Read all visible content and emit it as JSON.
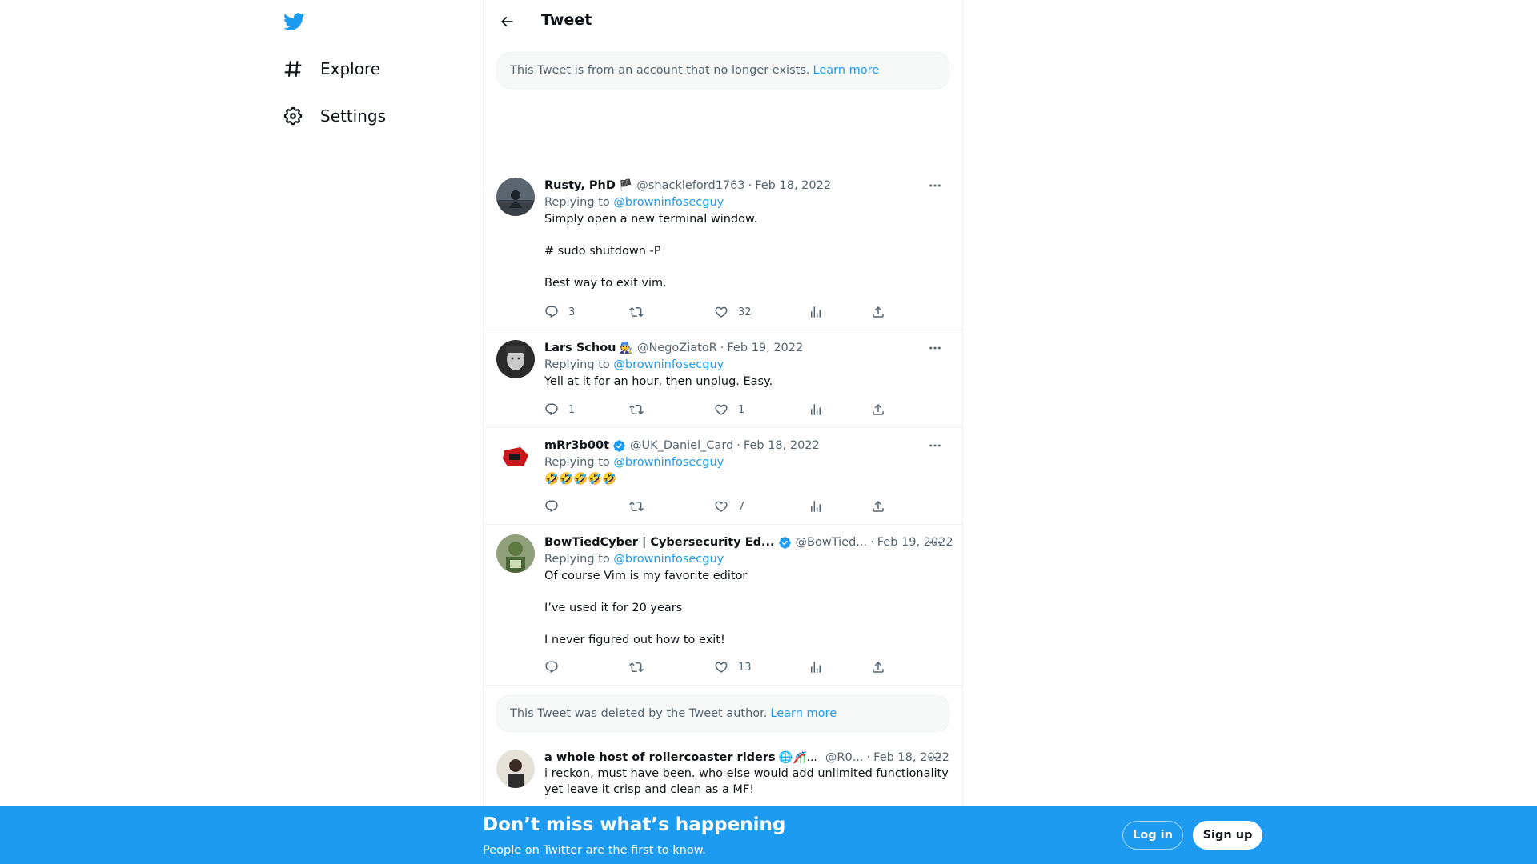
{
  "nav": {
    "logo": "twitter-bird-icon",
    "items": [
      {
        "label": "Explore",
        "icon": "hashtag-icon"
      },
      {
        "label": "Settings",
        "icon": "gear-icon"
      }
    ]
  },
  "header": {
    "title": "Tweet",
    "back_icon": "arrow-left-icon"
  },
  "notice_top": {
    "text": "This Tweet is from an account that no longer exists.",
    "link": "Learn more"
  },
  "notice_deleted": {
    "text": "This Tweet was deleted by the Tweet author.",
    "link": "Learn more"
  },
  "tweets": [
    {
      "name": "Rusty, PhD",
      "emoji": "🏴",
      "verified": false,
      "handle": "@shackleford1763",
      "date": "Feb 18, 2022",
      "replying_to_prefix": "Replying to",
      "replying_to": "@browninfosecguy",
      "lines": [
        "Simply open a new terminal window.",
        "# sudo shutdown -P",
        "Best way to exit vim."
      ],
      "stats": {
        "replies": "3",
        "retweets": "",
        "likes": "32"
      }
    },
    {
      "name": "Lars Schou",
      "emoji": "🧑‍🔧",
      "verified": false,
      "handle": "@NegoZiatoR",
      "date": "Feb 19, 2022",
      "replying_to_prefix": "Replying to",
      "replying_to": "@browninfosecguy",
      "lines": [
        "Yell at it for an hour, then unplug. Easy."
      ],
      "stats": {
        "replies": "1",
        "retweets": "",
        "likes": "1"
      }
    },
    {
      "name": "mRr3b00t",
      "emoji": "",
      "verified": true,
      "handle": "@UK_Daniel_Card",
      "date": "Feb 18, 2022",
      "replying_to_prefix": "Replying to",
      "replying_to": "@browninfosecguy",
      "lines": [
        "🤣🤣🤣🤣🤣"
      ],
      "stats": {
        "replies": "",
        "retweets": "",
        "likes": "7"
      }
    },
    {
      "name": "BowTiedCyber | Cybersecurity Ed...",
      "emoji": "",
      "verified": true,
      "handle": "@BowTied...",
      "date": "Feb 19, 2022",
      "replying_to_prefix": "Replying to",
      "replying_to": "@browninfosecguy",
      "lines": [
        "Of course Vim is my favorite editor",
        "I’ve used it for 20 years",
        "I never figured out how to exit!"
      ],
      "stats": {
        "replies": "",
        "retweets": "",
        "likes": "13"
      }
    },
    {
      "name": "a whole host of rollercoaster riders",
      "emoji": "🌐🎢...",
      "verified": false,
      "handle": "@R0...",
      "date": "Feb 18, 2022",
      "lines": [
        "i reckon, must have been. who else would add unlimited functionality yet leave it crisp and clean as a MF!"
      ]
    }
  ],
  "banner": {
    "title": "Don’t miss what’s happening",
    "subtitle": "People on Twitter are the first to know.",
    "login": "Log in",
    "signup": "Sign up"
  },
  "colors": {
    "accent": "#1d9bf0",
    "text": "#0f1419",
    "muted": "#536471",
    "border": "#eff3f4"
  }
}
